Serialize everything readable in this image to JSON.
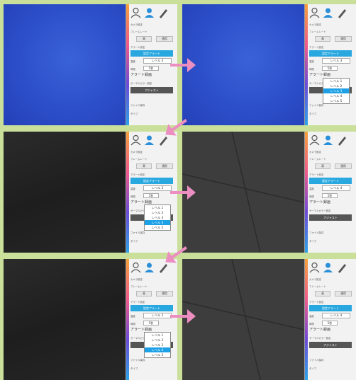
{
  "sidebar": {
    "camera_settings": "カメラ設定",
    "frame_rate": "フレームレート",
    "speed_value": "高",
    "apply_label": "適用",
    "alert_settings": "アラート設定",
    "alert_button": "設定アラート",
    "level_label": "温度",
    "level_values": [
      "レベル 3",
      "レベル 3",
      "レベル 3",
      "レベル 4",
      "レベル 3",
      "レベル 4"
    ],
    "time_label": "時間",
    "time_value": "5秒",
    "alert_record": "アラート録画",
    "thermal_settings": "サーマルカラー設定",
    "adjust_button": "アジャスト",
    "file_save": "ファイル保存",
    "file_type": "タイプ"
  },
  "dropdown": {
    "options": [
      "レベル 1",
      "レベル 2",
      "レベル 3",
      "レベル 4",
      "レベル 5"
    ]
  },
  "panels": [
    {
      "view": "blue",
      "dropdown": false,
      "selected": null
    },
    {
      "view": "blue",
      "dropdown": true,
      "selected": 2
    },
    {
      "view": "dark",
      "dropdown": true,
      "selected": 3
    },
    {
      "view": "floor",
      "dropdown": false,
      "selected": null
    },
    {
      "view": "dark",
      "dropdown": true,
      "selected": 3
    },
    {
      "view": "floor",
      "dropdown": false,
      "selected": null
    }
  ],
  "colors": {
    "background": "#c9df9a",
    "arrow": "#ec8fc0",
    "accent": "#29a8e0",
    "selected_option": "#1da0e6"
  }
}
